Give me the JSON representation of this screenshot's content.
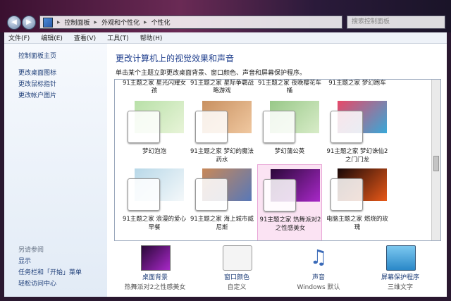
{
  "address": {
    "crumbs": [
      "控制面板",
      "外观和个性化",
      "个性化"
    ],
    "search_placeholder": "搜索控制面板"
  },
  "menu": [
    "文件(F)",
    "编辑(E)",
    "查看(V)",
    "工具(T)",
    "帮助(H)"
  ],
  "sidebar": {
    "links": [
      "控制面板主页",
      "更改桌面图标",
      "更改鼠标指针",
      "更改帐户图片"
    ],
    "see_also_title": "另请参阅",
    "see_also": [
      "显示",
      "任务栏和「开始」菜单",
      "轻松访问中心"
    ]
  },
  "main": {
    "heading": "更改计算机上的视觉效果和声音",
    "subtitle": "单击某个主题立即更改桌面背景、窗口颜色、声音和屏幕保护程序。",
    "partial_captions": [
      "91主题之家 星光闪耀女孩",
      "91主题之家 星际争霸战略游戏",
      "91主题之家 夜晚樱花车桶",
      "91主题之家 梦幻跑车"
    ],
    "themes": [
      {
        "caption": "梦幻泡泡",
        "selected": false,
        "colors": [
          "#b8e0a8",
          "#e8f4d8"
        ]
      },
      {
        "caption": "91主题之家 梦幻的魔法药水",
        "selected": false,
        "colors": [
          "#c89060",
          "#f0c8a0"
        ]
      },
      {
        "caption": "梦幻蒲公英",
        "selected": false,
        "colors": [
          "#98c888",
          "#d8ecc8"
        ]
      },
      {
        "caption": "91主题之家 梦幻诛仙2之门门龙",
        "selected": false,
        "colors": [
          "#e84868",
          "#38a8d8"
        ]
      },
      {
        "caption": "91主题之家 浪漫的爱心早餐",
        "selected": false,
        "colors": [
          "#b8d8e8",
          "#f4f8fa"
        ]
      },
      {
        "caption": "91主题之家 海上城市威尼斯",
        "selected": false,
        "colors": [
          "#c88858",
          "#5878b8"
        ]
      },
      {
        "caption": "91主题之家 热舞派对2之性感美女",
        "selected": true,
        "colors": [
          "#2a0838",
          "#a828c8"
        ]
      },
      {
        "caption": "电脑主题之家 燃烧的玫瑰",
        "selected": false,
        "colors": [
          "#180808",
          "#e85818"
        ]
      }
    ]
  },
  "bottom": [
    {
      "label": "桌面背景",
      "value": "热舞派对2之性感美女",
      "icon": "desktop-background-icon"
    },
    {
      "label": "窗口颜色",
      "value": "自定义",
      "icon": "window-color-icon"
    },
    {
      "label": "声音",
      "value": "Windows 默认",
      "icon": "sound-icon"
    },
    {
      "label": "屏幕保护程序",
      "value": "三维文字",
      "icon": "screensaver-icon"
    }
  ]
}
